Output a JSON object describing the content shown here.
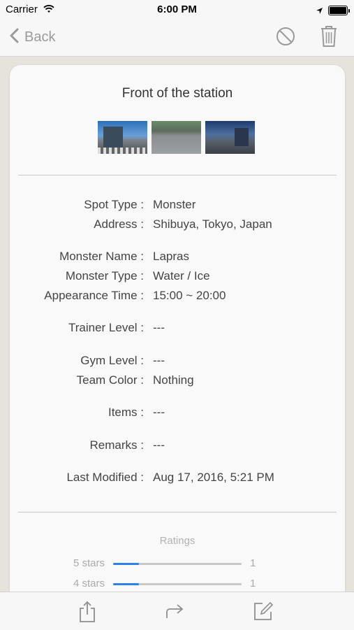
{
  "status_bar": {
    "carrier": "Carrier",
    "time": "6:00 PM"
  },
  "nav": {
    "back_label": "Back"
  },
  "card": {
    "title": "Front of the station",
    "fields": [
      {
        "label": "Spot Type :",
        "value": "Monster"
      },
      {
        "label": "Address :",
        "value": "Shibuya, Tokyo, Japan"
      },
      {
        "label": "Monster Name :",
        "value": "Lapras"
      },
      {
        "label": "Monster Type :",
        "value": "Water / Ice"
      },
      {
        "label": "Appearance Time :",
        "value": "15:00 ~ 20:00"
      },
      {
        "label": "Trainer Level :",
        "value": "---"
      },
      {
        "label": "Gym Level :",
        "value": "---"
      },
      {
        "label": "Team Color :",
        "value": "Nothing"
      },
      {
        "label": "Items :",
        "value": "---"
      },
      {
        "label": "Remarks :",
        "value": "---"
      },
      {
        "label": "Last Modified :",
        "value": "Aug 17, 2016, 5:21 PM"
      }
    ],
    "ratings": {
      "title": "Ratings",
      "rows": [
        {
          "label": "5 stars",
          "count": "1",
          "fraction": 0.2
        },
        {
          "label": "4 stars",
          "count": "1",
          "fraction": 0.2
        }
      ]
    }
  },
  "icons": [
    "back-chevron-icon",
    "no-entry-icon",
    "trash-icon",
    "share-icon",
    "forward-icon",
    "edit-icon"
  ],
  "colors": {
    "accent": "#2f80e8",
    "nav_tint": "#9a9a9a"
  }
}
